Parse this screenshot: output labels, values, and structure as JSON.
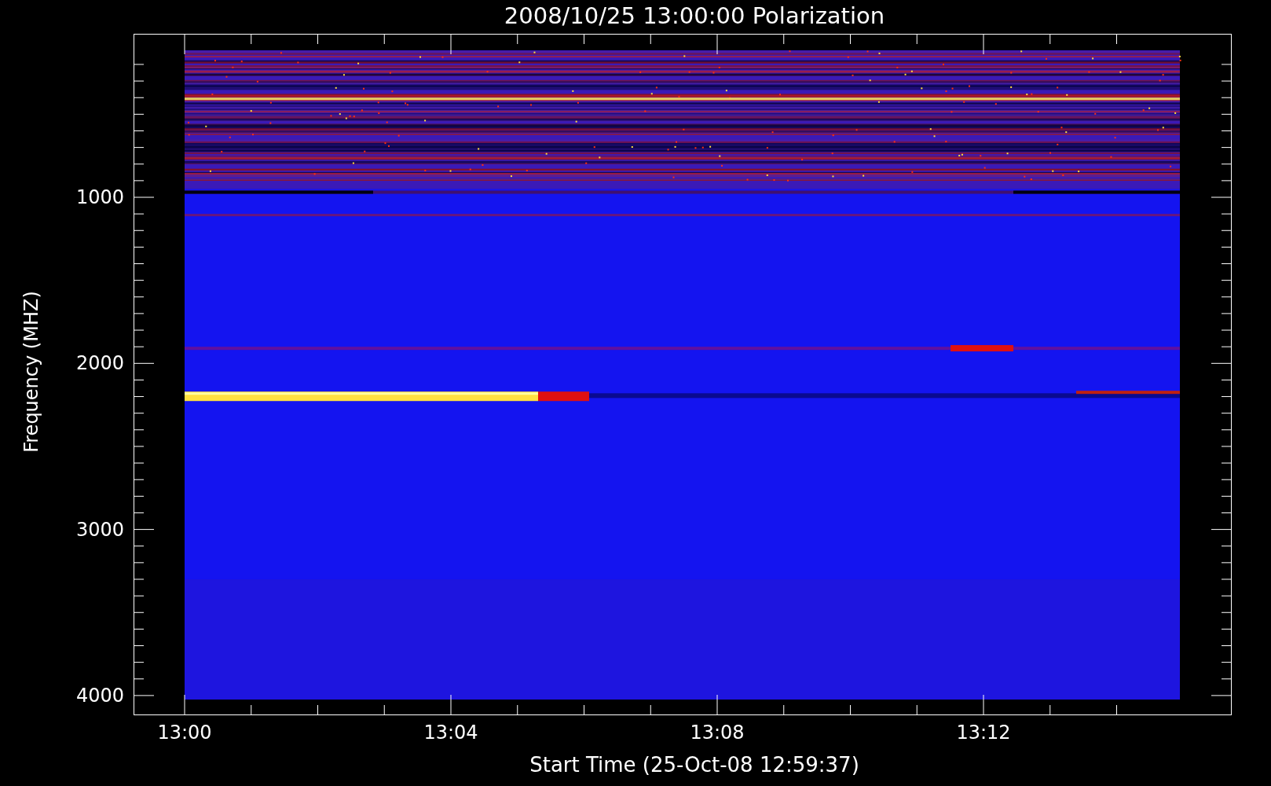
{
  "title": "2008/10/25 13:00:00 Polarization",
  "ylabel": "Frequency (MHZ)",
  "xlabel": "Start Time (25-Oct-08 12:59:37)",
  "yticks": [
    "1000",
    "2000",
    "3000",
    "4000"
  ],
  "xticks": [
    "13:00",
    "13:04",
    "13:08",
    "13:12"
  ]
}
